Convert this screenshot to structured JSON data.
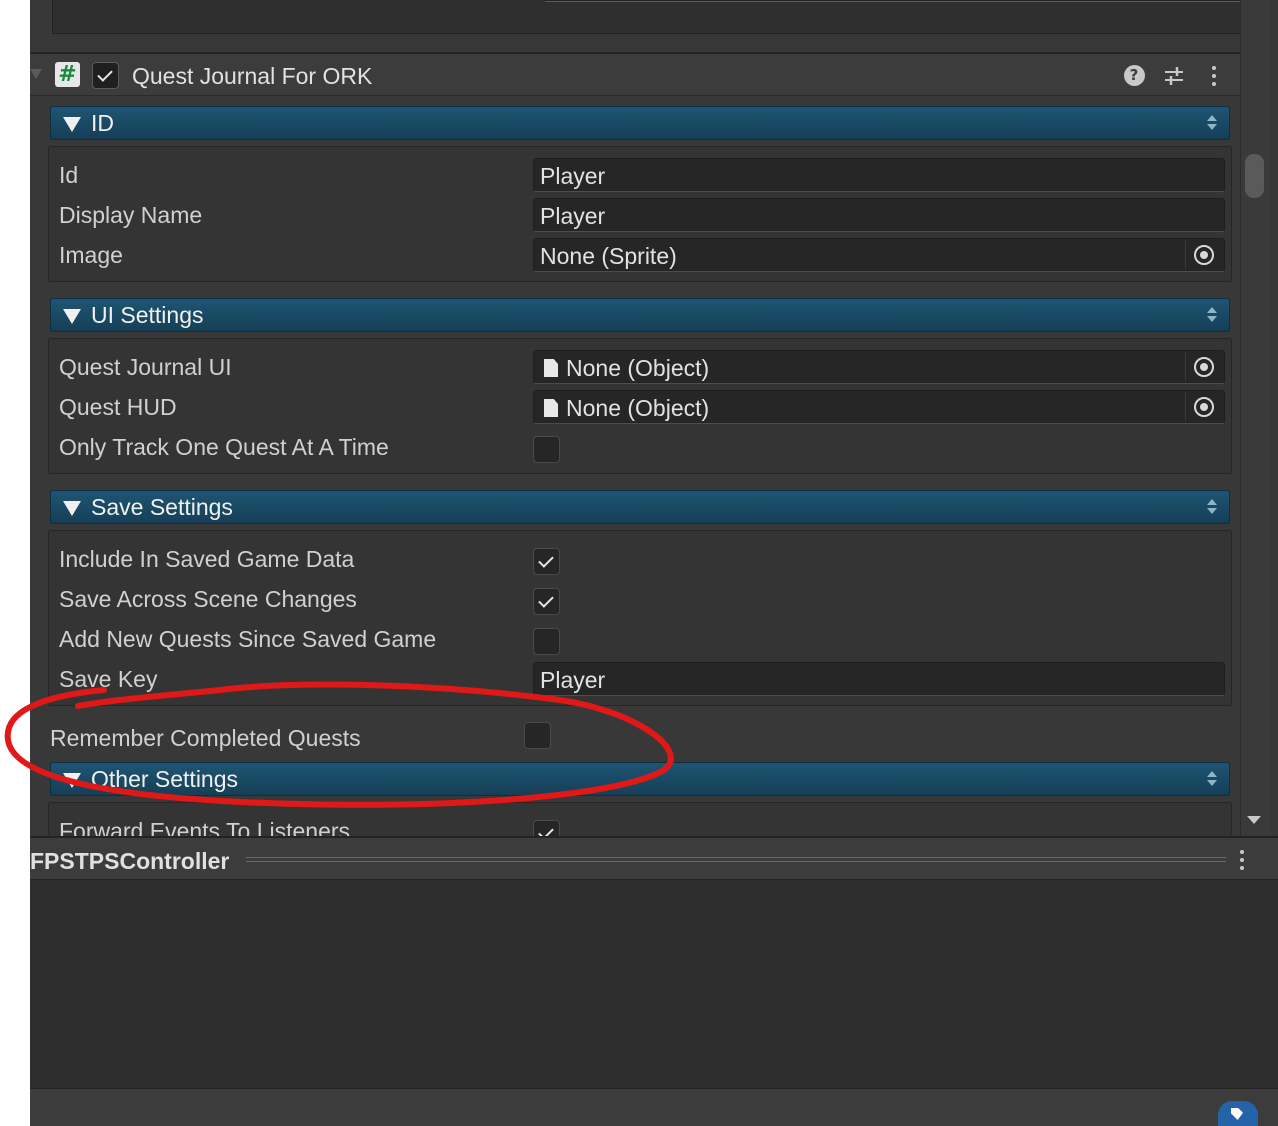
{
  "component": {
    "title": "Quest Journal For ORK",
    "enabled": true,
    "script_icon_glyph": "#",
    "help_glyph": "?",
    "icons": [
      "script-icon",
      "help-icon",
      "sliders-icon",
      "more-icon"
    ]
  },
  "sections": {
    "id": {
      "title": "ID",
      "rows": [
        {
          "label": "Id",
          "value": "Player"
        },
        {
          "label": "Display Name",
          "value": "Player"
        },
        {
          "label": "Image",
          "value": "None (Sprite)"
        }
      ]
    },
    "ui": {
      "title": "UI Settings",
      "rows": [
        {
          "label": "Quest Journal UI",
          "value": "None (Object)"
        },
        {
          "label": "Quest HUD",
          "value": "None (Object)"
        },
        {
          "label": "Only Track One Quest At A Time",
          "checked": false
        }
      ]
    },
    "save": {
      "title": "Save Settings",
      "rows": [
        {
          "label": "Include In Saved Game Data",
          "checked": true
        },
        {
          "label": "Save Across Scene Changes",
          "checked": true
        },
        {
          "label": "Add New Quests Since Saved Game",
          "checked": false
        },
        {
          "label": "Save Key",
          "value": "Player"
        }
      ]
    },
    "loose": {
      "label": "Remember Completed Quests",
      "checked": false
    },
    "other": {
      "title": "Other Settings",
      "rows": [
        {
          "label": "Forward Events To Listeners",
          "checked": true
        }
      ]
    }
  },
  "next_component": {
    "title": "FPSTPSController"
  },
  "colors": {
    "section_header": "#1e5573",
    "panel_bg": "#383838",
    "annotation": "#e01818"
  }
}
